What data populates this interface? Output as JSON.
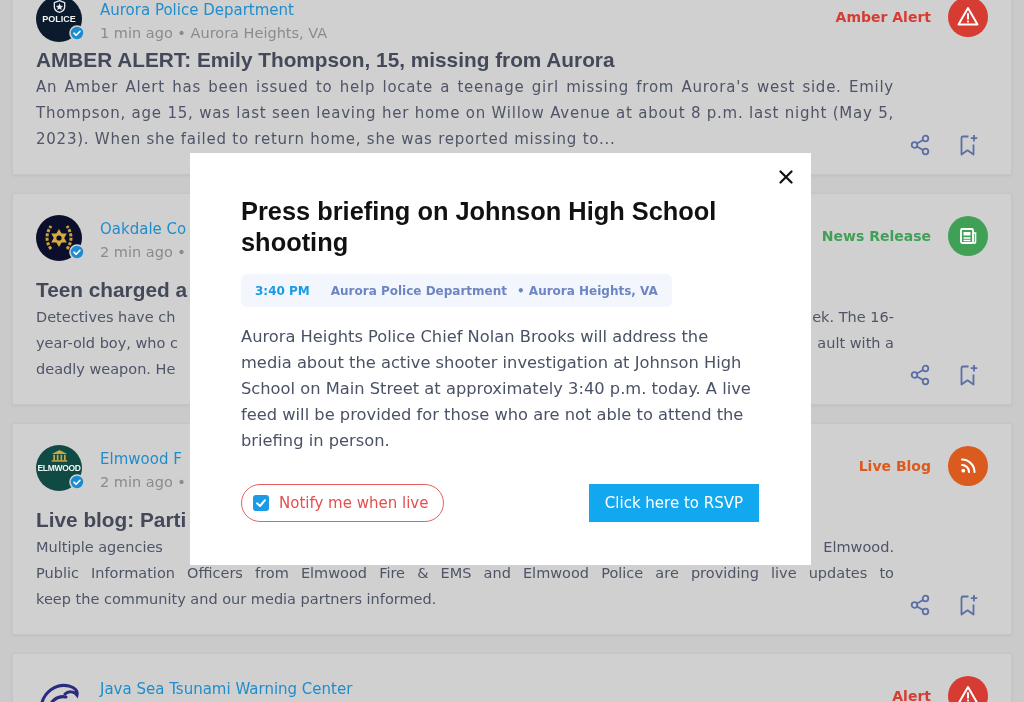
{
  "feed": {
    "posts": [
      {
        "avatar": {
          "kind": "police_badge",
          "text": "POLICE"
        },
        "verified": true,
        "agency": "Aurora Police Department",
        "meta": "1 min ago • Aurora Heights, VA",
        "category": {
          "label": "Amber Alert",
          "kind": "warning",
          "color": "#d63c32"
        },
        "title": "AMBER ALERT: Emily Thompson, 15, missing from Aurora",
        "body": "An Amber Alert has been issued to help locate a teenage girl missing from Aurora's west side. Emily Thompson, age 15, was last seen leaving her home on Willow Avenue at about 8 p.m. last night (May 5, 2023). When she failed to return home, she was reported missing to..."
      },
      {
        "avatar": {
          "kind": "star_emblem"
        },
        "verified": true,
        "agency": "Oakdale Co",
        "meta": "2 min ago •",
        "category": {
          "label": "News Release",
          "kind": "news",
          "color": "#40a055"
        },
        "title": "Teen charged a",
        "body_lines": [
          {
            "left": "Detectives have ch",
            "right": "ek. The 16-"
          },
          {
            "left": "year-old boy, who c",
            "right": "ault with a"
          },
          {
            "left": "deadly weapon. He"
          }
        ]
      },
      {
        "avatar": {
          "kind": "building",
          "text": "ELMWOOD"
        },
        "verified": true,
        "agency": "Elmwood F",
        "meta": "2 min ago •",
        "category": {
          "label": "Live Blog",
          "kind": "rss",
          "color": "#db5a1e"
        },
        "title": "Live blog: Parti",
        "body_lines": [
          {
            "left": "Multiple agencies",
            "right": "Elmwood."
          },
          {
            "left": "Public Information Officers from Elmwood Fire & EMS and Elmwood Police are providing live updates to"
          },
          {
            "left": "keep the community and our media partners informed."
          }
        ]
      },
      {
        "avatar": {
          "kind": "wave"
        },
        "agency": "Java Sea Tsunami Warning Center",
        "category": {
          "label": "Alert",
          "kind": "warning",
          "color": "#d63c32"
        }
      }
    ]
  },
  "modal": {
    "title": "Press briefing on Johnson High School shooting",
    "time": "3:40 PM",
    "source": "Aurora Police Department",
    "location": "• Aurora Heights, VA",
    "text": "Aurora Heights Police Chief Nolan Brooks will address the media about the active shooter investigation at Johnson High School on Main Street at approximately 3:40 p.m. today. A live feed will be provided for those who are not able to attend the briefing in person.",
    "notify": {
      "label": "Notify me when live",
      "checked": true
    },
    "button": "Click here to RSVP"
  }
}
